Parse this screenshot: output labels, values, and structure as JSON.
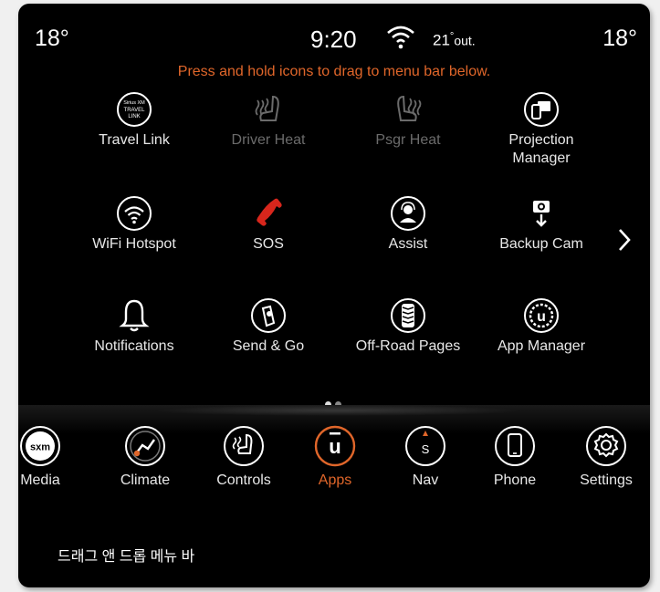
{
  "status": {
    "temp_left": "18°",
    "time": "9:20",
    "outside_value": "21",
    "outside_unit": "out.",
    "degree_symbol": "°",
    "temp_right": "18°"
  },
  "hint": "Press and hold icons to drag to menu bar below.",
  "apps": [
    {
      "label": "Travel Link",
      "icon": "siriusxm-travel-link-icon",
      "icon_text": [
        "Sirius XM",
        "TRAVEL",
        "LINK"
      ],
      "enabled": true
    },
    {
      "label": "Driver Heat",
      "icon": "heated-seat-driver-icon",
      "enabled": false
    },
    {
      "label": "Psgr Heat",
      "icon": "heated-seat-passenger-icon",
      "enabled": false
    },
    {
      "label": "Projection",
      "label2": "Manager",
      "icon": "projection-manager-icon",
      "enabled": true
    },
    {
      "label": "WiFi Hotspot",
      "icon": "wifi-icon",
      "enabled": true
    },
    {
      "label": "SOS",
      "icon": "phone-handset-icon",
      "enabled": true
    },
    {
      "label": "Assist",
      "icon": "assist-agent-icon",
      "enabled": true
    },
    {
      "label": "Backup Cam",
      "icon": "camera-icon",
      "enabled": true
    },
    {
      "label": "Notifications",
      "icon": "bell-icon",
      "enabled": true
    },
    {
      "label": "Send & Go",
      "icon": "send-and-go-icon",
      "enabled": true
    },
    {
      "label": "Off-Road Pages",
      "icon": "tire-tread-icon",
      "enabled": true
    },
    {
      "label": "App Manager",
      "icon": "uconnect-app-icon",
      "icon_text": "u",
      "enabled": true
    }
  ],
  "page_indicator": {
    "current": 1,
    "total": 2
  },
  "menu_bar": [
    {
      "label": "Media",
      "icon": "siriusxm-icon",
      "icon_text": "sxm"
    },
    {
      "label": "Climate",
      "icon": "climate-icon"
    },
    {
      "label": "Controls",
      "icon": "controls-icon"
    },
    {
      "label": "Apps",
      "icon": "uconnect-apps-icon",
      "icon_text": "u",
      "active": true
    },
    {
      "label": "Nav",
      "icon": "compass-icon",
      "icon_text": "S"
    },
    {
      "label": "Phone",
      "icon": "phone-icon"
    },
    {
      "label": "Settings",
      "icon": "gear-icon"
    }
  ],
  "caption": "드래그 앤 드롭 메뉴 바",
  "colors": {
    "accent": "#e0662a",
    "sos_red": "#d8261c",
    "background": "#000000",
    "disabled": "#6b6b6b"
  }
}
